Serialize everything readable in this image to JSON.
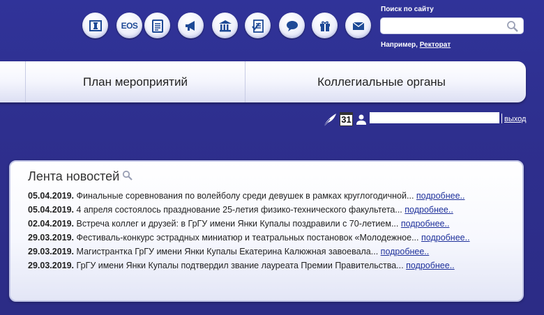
{
  "toolbar": {
    "icons": [
      {
        "name": "info-book-icon"
      },
      {
        "name": "eos-icon",
        "label": "EOS"
      },
      {
        "name": "calendar-icon"
      },
      {
        "name": "megaphone-icon"
      },
      {
        "name": "building-icon"
      },
      {
        "name": "checklist-icon"
      },
      {
        "name": "chat-bubble-icon"
      },
      {
        "name": "gift-icon"
      },
      {
        "name": "mail-icon"
      }
    ],
    "icon_color": "#1e4a96"
  },
  "search": {
    "label": "Поиск по сайту",
    "value": "",
    "hint_prefix": "Например,",
    "hint_link": "Ректорат"
  },
  "menu": {
    "items": [
      {
        "label": "План мероприятий"
      },
      {
        "label": "Коллегиальные органы"
      }
    ]
  },
  "user": {
    "calendar_day": "31",
    "logout_label": "выход"
  },
  "news": {
    "title": "Лента новостей",
    "more_label": "подробнее..",
    "items": [
      {
        "date": "05.04.2019.",
        "text": "Финальные соревнования по волейболу среди девушек в рамках круглогодичной..."
      },
      {
        "date": "05.04.2019.",
        "text": "4 апреля состоялось празднование 25-летия физико-технического факультета..."
      },
      {
        "date": "02.04.2019.",
        "text": "Встреча коллег и друзей: в ГрГУ имени Янки Купалы поздравили с 70-летием..."
      },
      {
        "date": "29.03.2019.",
        "text": "Фестиваль-конкурс эстрадных миниатюр и театральных постановок «Молодежное..."
      },
      {
        "date": "29.03.2019.",
        "text": "Магистрантка ГрГУ имени Янки Купалы Екатерина Калюжная завоевала..."
      },
      {
        "date": "29.03.2019.",
        "text": "ГрГУ имени Янки Купалы подтвердил звание лауреата Премии Правительства..."
      }
    ]
  },
  "colors": {
    "background": "#2e2f8e",
    "link": "#1d2f9a"
  }
}
